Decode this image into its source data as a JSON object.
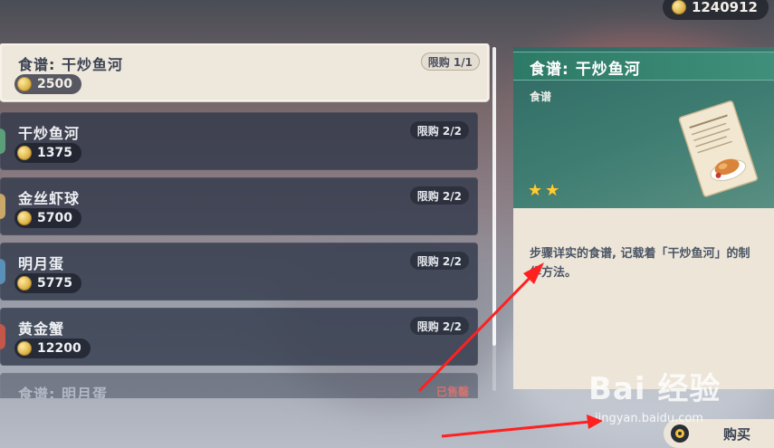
{
  "header": {
    "currency_amount": "1240912"
  },
  "shop_items": [
    {
      "name": "食谱: 干炒鱼河",
      "price": "2500",
      "limit": "限购 1/1",
      "state": "selected"
    },
    {
      "name": "干炒鱼河",
      "price": "1375",
      "limit": "限购 2/2",
      "state": "normal"
    },
    {
      "name": "金丝虾球",
      "price": "5700",
      "limit": "限购 2/2",
      "state": "normal"
    },
    {
      "name": "明月蛋",
      "price": "5775",
      "limit": "限购 2/2",
      "state": "normal"
    },
    {
      "name": "黄金蟹",
      "price": "12200",
      "limit": "限购 2/2",
      "state": "normal"
    },
    {
      "name": "食谱: 明月蛋",
      "sold_label": "已售罄",
      "state": "sold"
    }
  ],
  "detail": {
    "title": "食谱: 干炒鱼河",
    "type": "食谱",
    "rarity_stars": 2,
    "description": "步骤详实的食谱, 记载着「干炒鱼河」的制作方法。"
  },
  "footer": {
    "buy_label": "购买"
  },
  "watermark": {
    "brand": "Bai 经验",
    "url": "jingyan.baidu.com"
  },
  "colors": {
    "accent_teal": "#3f8f7a",
    "annotation_red": "#ff2020",
    "coin_gold": "#e0b84e"
  }
}
